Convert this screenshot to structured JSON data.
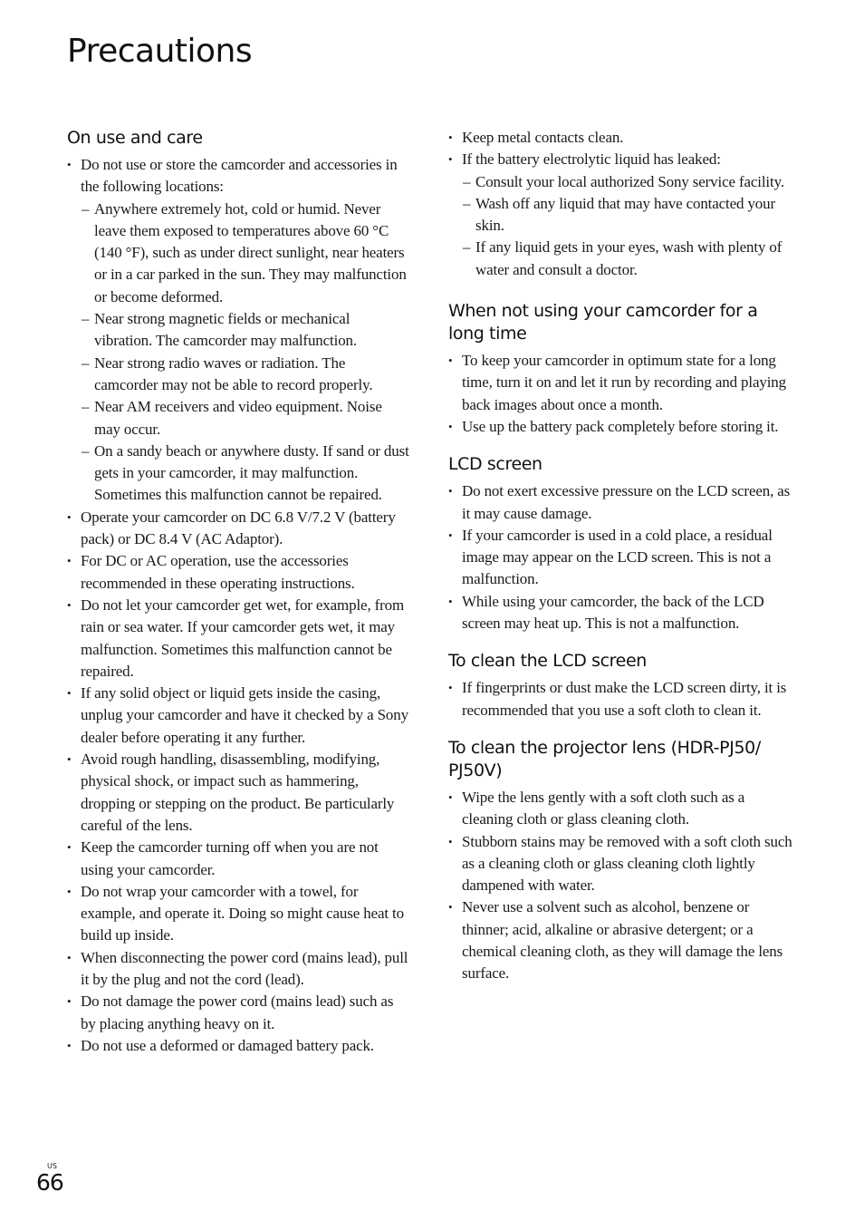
{
  "page": {
    "title": "Precautions",
    "region_label": "US",
    "page_number": "66"
  },
  "left_column": {
    "sections": [
      {
        "heading": "On use and care",
        "items": [
          {
            "text": "Do not use or store the camcorder and accessories in the following locations:",
            "sub_items": [
              "Anywhere extremely hot, cold or humid. Never leave them exposed to temperatures above 60 °C (140 °F), such as under direct sunlight, near heaters or in a car parked in the sun. They may malfunction or become deformed.",
              "Near strong magnetic fields or mechanical vibration. The camcorder may malfunction.",
              "Near strong radio waves or radiation. The camcorder may not be able to record properly.",
              "Near AM receivers and video equipment. Noise may occur.",
              "On a sandy beach or anywhere dusty. If sand or dust gets in your camcorder, it may malfunction. Sometimes this malfunction cannot be repaired."
            ]
          },
          {
            "text": "Operate your camcorder on DC 6.8 V/7.2 V (battery pack) or DC 8.4 V (AC Adaptor)."
          },
          {
            "text": "For DC or AC operation, use the accessories recommended in these operating instructions."
          },
          {
            "text": "Do not let your camcorder get wet, for example, from rain or sea water. If your camcorder gets wet, it may malfunction. Sometimes this malfunction cannot be repaired."
          },
          {
            "text": "If any solid object or liquid gets inside the casing, unplug your camcorder and have it checked by a Sony dealer before operating it any further."
          },
          {
            "text": "Avoid rough handling, disassembling, modifying, physical shock, or impact such as hammering, dropping or stepping on the product. Be particularly careful of the lens."
          },
          {
            "text": "Keep the camcorder turning off when you are not using your camcorder."
          },
          {
            "text": "Do not wrap your camcorder with a towel, for example, and operate it. Doing so might cause heat to build up inside."
          },
          {
            "text": "When disconnecting the power cord (mains lead), pull it by the plug and not the cord (lead)."
          },
          {
            "text": "Do not damage the power cord (mains lead) such as by placing anything heavy on it."
          },
          {
            "text": "Do not use a deformed or damaged battery pack."
          }
        ]
      }
    ]
  },
  "right_column": {
    "sections": [
      {
        "heading": "",
        "items": [
          {
            "text": "Keep metal contacts clean."
          },
          {
            "text": "If the battery electrolytic liquid has leaked:",
            "sub_items": [
              "Consult your local authorized Sony service facility.",
              "Wash off any liquid that may have contacted your skin.",
              "If any liquid gets in your eyes, wash with plenty of water and consult a doctor."
            ]
          }
        ]
      },
      {
        "heading": "When not using your camcorder for a long time",
        "items": [
          {
            "text": "To keep your camcorder in optimum state for a long time, turn it on and let it run by recording and playing back images about once a month."
          },
          {
            "text": "Use up the battery pack completely before storing it."
          }
        ]
      },
      {
        "heading": "LCD screen",
        "items": [
          {
            "text": "Do not exert excessive pressure on the LCD screen, as it may cause damage."
          },
          {
            "text": "If your camcorder is used in a cold place, a residual image may appear on the LCD screen. This is not a malfunction."
          },
          {
            "text": "While using your camcorder, the back of the LCD screen may heat up. This is not a malfunction."
          }
        ]
      },
      {
        "heading": "To clean the LCD screen",
        "items": [
          {
            "text": "If fingerprints or dust make the LCD screen dirty, it is recommended that you use a soft cloth to clean it."
          }
        ]
      },
      {
        "heading": "To clean the projector lens (HDR-PJ50/ PJ50V)",
        "items": [
          {
            "text": "Wipe the lens gently with a soft cloth such as a cleaning cloth or glass cleaning cloth."
          },
          {
            "text": "Stubborn stains may be removed with a soft cloth such as a cleaning cloth or glass cleaning cloth lightly dampened with water."
          },
          {
            "text": "Never use a solvent such as alcohol, benzene or thinner; acid, alkaline or abrasive detergent; or a chemical cleaning cloth, as they will damage the lens surface."
          }
        ]
      }
    ]
  },
  "glyphs": {
    "bullet": "•",
    "dash": "–"
  }
}
